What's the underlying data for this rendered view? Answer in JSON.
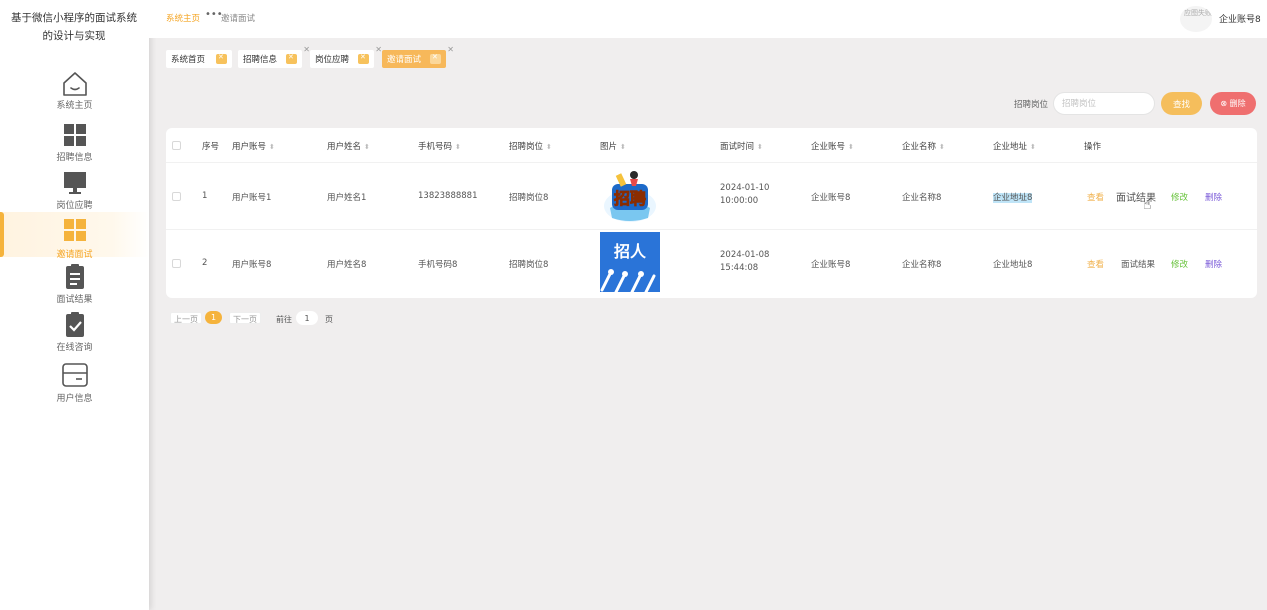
{
  "app": {
    "title": "基于微信小程序的面试系统的设计与实现"
  },
  "sidebar": {
    "items": [
      {
        "label": "系统主页",
        "icon": "home-icon"
      },
      {
        "label": "招聘信息",
        "icon": "grid-icon"
      },
      {
        "label": "岗位应聘",
        "icon": "monitor-icon"
      },
      {
        "label": "邀请面试",
        "icon": "grid-icon",
        "active": true
      },
      {
        "label": "面试结果",
        "icon": "clipboard-list-icon"
      },
      {
        "label": "在线咨询",
        "icon": "clipboard-check-icon"
      },
      {
        "label": "用户信息",
        "icon": "card-icon"
      }
    ]
  },
  "header": {
    "breadcrumb_home": "系统主页",
    "breadcrumb_current": "邀请面试",
    "avatar_alt": "应图失败",
    "user": "企业账号8"
  },
  "tags": [
    "系统首页",
    "招聘信息",
    "岗位应聘",
    "邀请面试"
  ],
  "search": {
    "label": "招聘岗位",
    "placeholder": "招聘岗位",
    "search_button": "查找",
    "delete_button": "删除"
  },
  "table": {
    "columns": [
      "序号",
      "用户账号",
      "用户姓名",
      "手机号码",
      "招聘岗位",
      "图片",
      "面试时间",
      "企业账号",
      "企业名称",
      "企业地址",
      "操作"
    ],
    "rows": [
      {
        "index": "1",
        "account": "用户账号1",
        "name": "用户姓名1",
        "phone": "13823888881",
        "position": "招聘岗位8",
        "image": "招聘",
        "time": "2024-01-10 10:00:00",
        "company_account": "企业账号8",
        "company_name": "企业名称8",
        "company_address": "企业地址8"
      },
      {
        "index": "2",
        "account": "用户账号8",
        "name": "用户姓名8",
        "phone": "手机号码8",
        "position": "招聘岗位8",
        "image": "招人",
        "time": "2024-01-08 15:44:08",
        "company_account": "企业账号8",
        "company_name": "企业名称8",
        "company_address": "企业地址8"
      }
    ],
    "actions": {
      "view": "查看",
      "result": "面试结果",
      "edit": "修改",
      "delete": "删除"
    }
  },
  "pagination": {
    "prev": "上一页",
    "current": "1",
    "next": "下一页",
    "goto": "前往",
    "input": "1",
    "page": "页"
  },
  "colors": {
    "accent": "#f5b33c",
    "danger": "#ef6f6f",
    "edit": "#67c23a",
    "delete": "#7a5ad8"
  }
}
